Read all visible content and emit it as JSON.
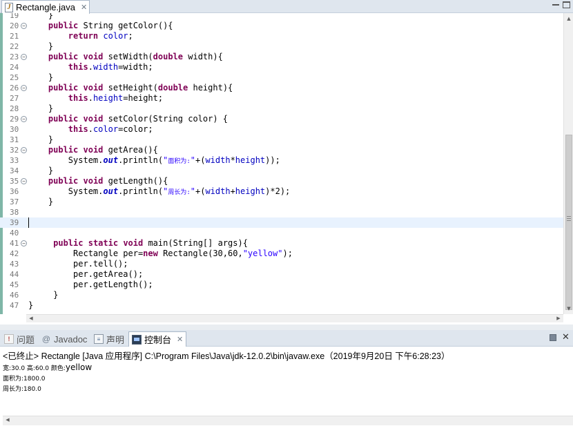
{
  "editor": {
    "tab_label": "Rectangle.java",
    "tab_icon": "java-file-icon",
    "close_symbol": "✕"
  },
  "code": {
    "current_line": 39,
    "lines": [
      {
        "n": "19",
        "fold": "",
        "segs": [
          {
            "t": "    }",
            "c": ""
          }
        ]
      },
      {
        "n": "20",
        "fold": "⊖",
        "segs": [
          {
            "t": "    ",
            "c": ""
          },
          {
            "t": "public",
            "c": "kw"
          },
          {
            "t": " String getColor(){",
            "c": ""
          }
        ]
      },
      {
        "n": "21",
        "fold": "",
        "segs": [
          {
            "t": "        ",
            "c": ""
          },
          {
            "t": "return",
            "c": "kw"
          },
          {
            "t": " ",
            "c": ""
          },
          {
            "t": "color",
            "c": "fld"
          },
          {
            "t": ";",
            "c": ""
          }
        ]
      },
      {
        "n": "22",
        "fold": "",
        "segs": [
          {
            "t": "    }",
            "c": ""
          }
        ]
      },
      {
        "n": "23",
        "fold": "⊖",
        "segs": [
          {
            "t": "    ",
            "c": ""
          },
          {
            "t": "public",
            "c": "kw"
          },
          {
            "t": " ",
            "c": ""
          },
          {
            "t": "void",
            "c": "kw"
          },
          {
            "t": " setWidth(",
            "c": ""
          },
          {
            "t": "double",
            "c": "kw"
          },
          {
            "t": " width){",
            "c": ""
          }
        ]
      },
      {
        "n": "24",
        "fold": "",
        "segs": [
          {
            "t": "        ",
            "c": ""
          },
          {
            "t": "this",
            "c": "kw"
          },
          {
            "t": ".",
            "c": ""
          },
          {
            "t": "width",
            "c": "fld"
          },
          {
            "t": "=width;",
            "c": ""
          }
        ]
      },
      {
        "n": "25",
        "fold": "",
        "segs": [
          {
            "t": "    }",
            "c": ""
          }
        ]
      },
      {
        "n": "26",
        "fold": "⊖",
        "segs": [
          {
            "t": "    ",
            "c": ""
          },
          {
            "t": "public",
            "c": "kw"
          },
          {
            "t": " ",
            "c": ""
          },
          {
            "t": "void",
            "c": "kw"
          },
          {
            "t": " setHeight(",
            "c": ""
          },
          {
            "t": "double",
            "c": "kw"
          },
          {
            "t": " height){",
            "c": ""
          }
        ]
      },
      {
        "n": "27",
        "fold": "",
        "segs": [
          {
            "t": "        ",
            "c": ""
          },
          {
            "t": "this",
            "c": "kw"
          },
          {
            "t": ".",
            "c": ""
          },
          {
            "t": "height",
            "c": "fld"
          },
          {
            "t": "=height;",
            "c": ""
          }
        ]
      },
      {
        "n": "28",
        "fold": "",
        "segs": [
          {
            "t": "    }",
            "c": ""
          }
        ]
      },
      {
        "n": "29",
        "fold": "⊖",
        "segs": [
          {
            "t": "    ",
            "c": ""
          },
          {
            "t": "public",
            "c": "kw"
          },
          {
            "t": " ",
            "c": ""
          },
          {
            "t": "void",
            "c": "kw"
          },
          {
            "t": " setColor(String color) {",
            "c": ""
          }
        ]
      },
      {
        "n": "30",
        "fold": "",
        "segs": [
          {
            "t": "        ",
            "c": ""
          },
          {
            "t": "this",
            "c": "kw"
          },
          {
            "t": ".",
            "c": ""
          },
          {
            "t": "color",
            "c": "fld"
          },
          {
            "t": "=color;",
            "c": ""
          }
        ]
      },
      {
        "n": "31",
        "fold": "",
        "segs": [
          {
            "t": "    }",
            "c": ""
          }
        ]
      },
      {
        "n": "32",
        "fold": "⊖",
        "segs": [
          {
            "t": "    ",
            "c": ""
          },
          {
            "t": "public",
            "c": "kw"
          },
          {
            "t": " ",
            "c": ""
          },
          {
            "t": "void",
            "c": "kw"
          },
          {
            "t": " getArea(){",
            "c": ""
          }
        ]
      },
      {
        "n": "33",
        "fold": "",
        "segs": [
          {
            "t": "        System.",
            "c": ""
          },
          {
            "t": "out",
            "c": "st"
          },
          {
            "t": ".println(",
            "c": ""
          },
          {
            "t": "\"",
            "c": "str"
          },
          {
            "t": "面积为:",
            "c": "cstr"
          },
          {
            "t": "\"",
            "c": "str"
          },
          {
            "t": "+(",
            "c": ""
          },
          {
            "t": "width",
            "c": "fld"
          },
          {
            "t": "*",
            "c": ""
          },
          {
            "t": "height",
            "c": "fld"
          },
          {
            "t": "));",
            "c": ""
          }
        ]
      },
      {
        "n": "34",
        "fold": "",
        "segs": [
          {
            "t": "    }",
            "c": ""
          }
        ]
      },
      {
        "n": "35",
        "fold": "⊖",
        "segs": [
          {
            "t": "    ",
            "c": ""
          },
          {
            "t": "public",
            "c": "kw"
          },
          {
            "t": " ",
            "c": ""
          },
          {
            "t": "void",
            "c": "kw"
          },
          {
            "t": " getLength(){",
            "c": ""
          }
        ]
      },
      {
        "n": "36",
        "fold": "",
        "segs": [
          {
            "t": "        System.",
            "c": ""
          },
          {
            "t": "out",
            "c": "st"
          },
          {
            "t": ".println(",
            "c": ""
          },
          {
            "t": "\"",
            "c": "str"
          },
          {
            "t": "周长为:",
            "c": "cstr"
          },
          {
            "t": "\"",
            "c": "str"
          },
          {
            "t": "+(",
            "c": ""
          },
          {
            "t": "width",
            "c": "fld"
          },
          {
            "t": "+",
            "c": ""
          },
          {
            "t": "height",
            "c": "fld"
          },
          {
            "t": ")*2);",
            "c": ""
          }
        ]
      },
      {
        "n": "37",
        "fold": "",
        "segs": [
          {
            "t": "    }",
            "c": ""
          }
        ]
      },
      {
        "n": "38",
        "fold": "",
        "segs": []
      },
      {
        "n": "39",
        "fold": "",
        "segs": []
      },
      {
        "n": "40",
        "fold": "",
        "segs": []
      },
      {
        "n": "41",
        "fold": "⊖",
        "segs": [
          {
            "t": "     ",
            "c": ""
          },
          {
            "t": "public",
            "c": "kw"
          },
          {
            "t": " ",
            "c": ""
          },
          {
            "t": "static",
            "c": "kw"
          },
          {
            "t": " ",
            "c": ""
          },
          {
            "t": "void",
            "c": "kw"
          },
          {
            "t": " main(String[] args){",
            "c": ""
          }
        ]
      },
      {
        "n": "42",
        "fold": "",
        "segs": [
          {
            "t": "         Rectangle per=",
            "c": ""
          },
          {
            "t": "new",
            "c": "kw"
          },
          {
            "t": " Rectangle(30,60,",
            "c": ""
          },
          {
            "t": "\"yellow\"",
            "c": "str"
          },
          {
            "t": ");",
            "c": ""
          }
        ]
      },
      {
        "n": "43",
        "fold": "",
        "segs": [
          {
            "t": "         per.tell();",
            "c": ""
          }
        ]
      },
      {
        "n": "44",
        "fold": "",
        "segs": [
          {
            "t": "         per.getArea();",
            "c": ""
          }
        ]
      },
      {
        "n": "45",
        "fold": "",
        "segs": [
          {
            "t": "         per.getLength();",
            "c": ""
          }
        ]
      },
      {
        "n": "46",
        "fold": "",
        "segs": [
          {
            "t": "     }",
            "c": ""
          }
        ]
      },
      {
        "n": "47",
        "fold": "",
        "segs": [
          {
            "t": "}",
            "c": ""
          }
        ]
      }
    ]
  },
  "panel": {
    "tabs": [
      {
        "label": "问题",
        "icon": "problems-icon",
        "active": false
      },
      {
        "label": "Javadoc",
        "icon": "javadoc-icon",
        "active": false
      },
      {
        "label": "声明",
        "icon": "declaration-icon",
        "active": false
      },
      {
        "label": "控制台",
        "icon": "console-icon",
        "active": true
      }
    ],
    "close_symbol": "✕"
  },
  "console": {
    "header": "<已终止> Rectangle [Java 应用程序] C:\\Program Files\\Java\\jdk-12.0.2\\bin\\javaw.exe（2019年9月20日 下午6:28:23）",
    "line1_prefix": "宽:30.0 高:60.0 颜色:",
    "line1_value": "yellow",
    "line2": "面积为:1800.0",
    "line3": "周长为:180.0"
  },
  "colors": {
    "keyword": "#7f0055",
    "field": "#0000c0",
    "string": "#2a00ff",
    "current_line": "#e8f2fe",
    "tabbar": "#dfe6ee"
  }
}
